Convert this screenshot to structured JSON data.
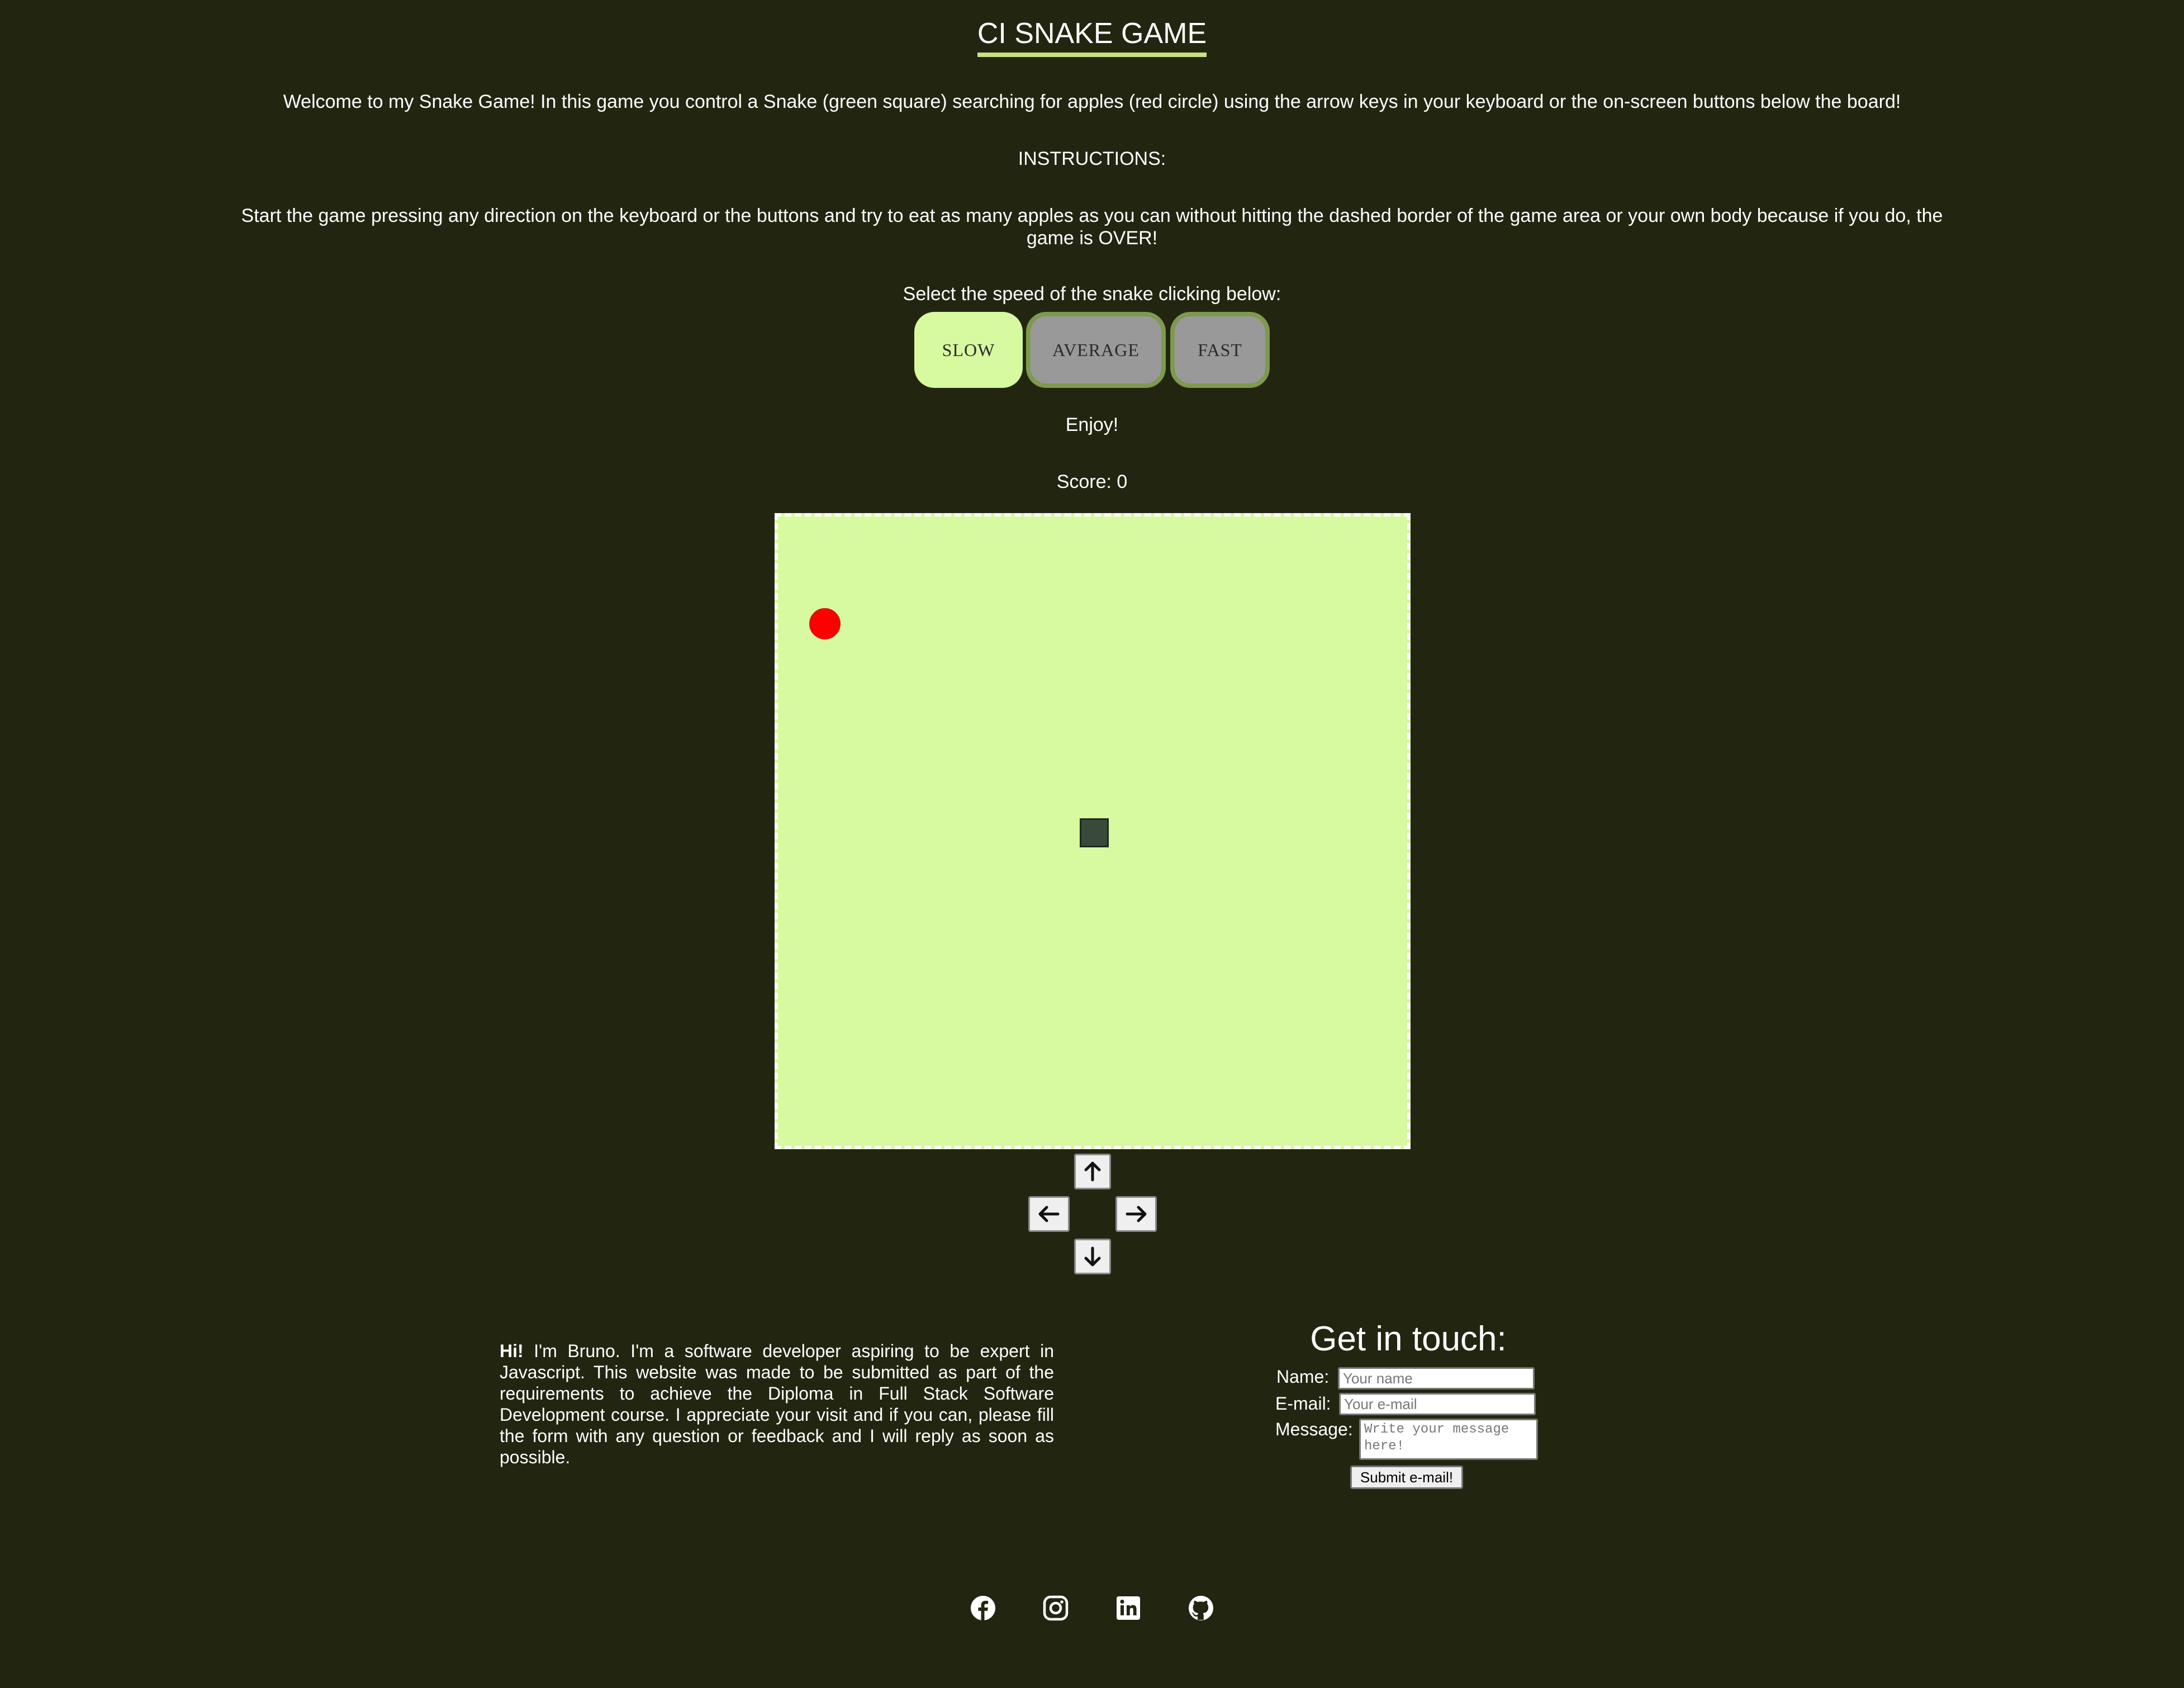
{
  "header": {
    "title": "CI SNAKE GAME",
    "accent_color": "#c9e37d"
  },
  "intro": {
    "welcome": "Welcome to my Snake Game! In this game you control a Snake (green square) searching for apples (red circle) using the arrow keys in your keyboard or the on-screen buttons below the board!",
    "instructions_heading": "INSTRUCTIONS:",
    "instructions": "Start the game pressing any direction on the keyboard or the buttons and try to eat as many apples as you can without hitting the dashed border of the game area or your own body because if you do, the game is OVER!",
    "speed_prompt": "Select the speed of the snake clicking below:"
  },
  "speed": {
    "options": [
      {
        "label": "SLOW",
        "selected": true
      },
      {
        "label": "AVERAGE",
        "selected": false
      },
      {
        "label": "FAST",
        "selected": false
      }
    ]
  },
  "enjoy": "Enjoy!",
  "score": {
    "text": "Score: 0"
  },
  "board": {
    "background_color": "#d7f99f",
    "border": "dashed white",
    "apple_color": "#ff0000",
    "snake_color": "#3a4a3a"
  },
  "controls": {
    "up_icon": "arrow-up-icon",
    "left_icon": "arrow-left-icon",
    "right_icon": "arrow-right-icon",
    "down_icon": "arrow-down-icon"
  },
  "about": {
    "greeting": "Hi!",
    "text": " I'm Bruno. I'm a software developer aspiring to be expert in Javascript. This website was made to be submitted as part of the requirements to achieve the Diploma in Full Stack Software Development course. I appreciate your visit and if you can, please fill the form with any question or feedback and I will reply as soon as possible."
  },
  "contact": {
    "title": "Get in touch:",
    "name_label": "Name:",
    "name_placeholder": "Your name",
    "email_label": "E-mail:",
    "email_placeholder": "Your e-mail",
    "message_label": "Message:",
    "message_placeholder": "Write your message here!",
    "submit_label": "Submit e-mail!"
  },
  "social": [
    {
      "icon": "facebook-icon"
    },
    {
      "icon": "instagram-icon"
    },
    {
      "icon": "linkedin-icon"
    },
    {
      "icon": "github-icon"
    }
  ],
  "colors": {
    "page_background": "#222611",
    "text": "#ffffff",
    "button_selected": "#d7f99f",
    "button_unselected": "#999999",
    "button_border": "#7d9a4f"
  }
}
